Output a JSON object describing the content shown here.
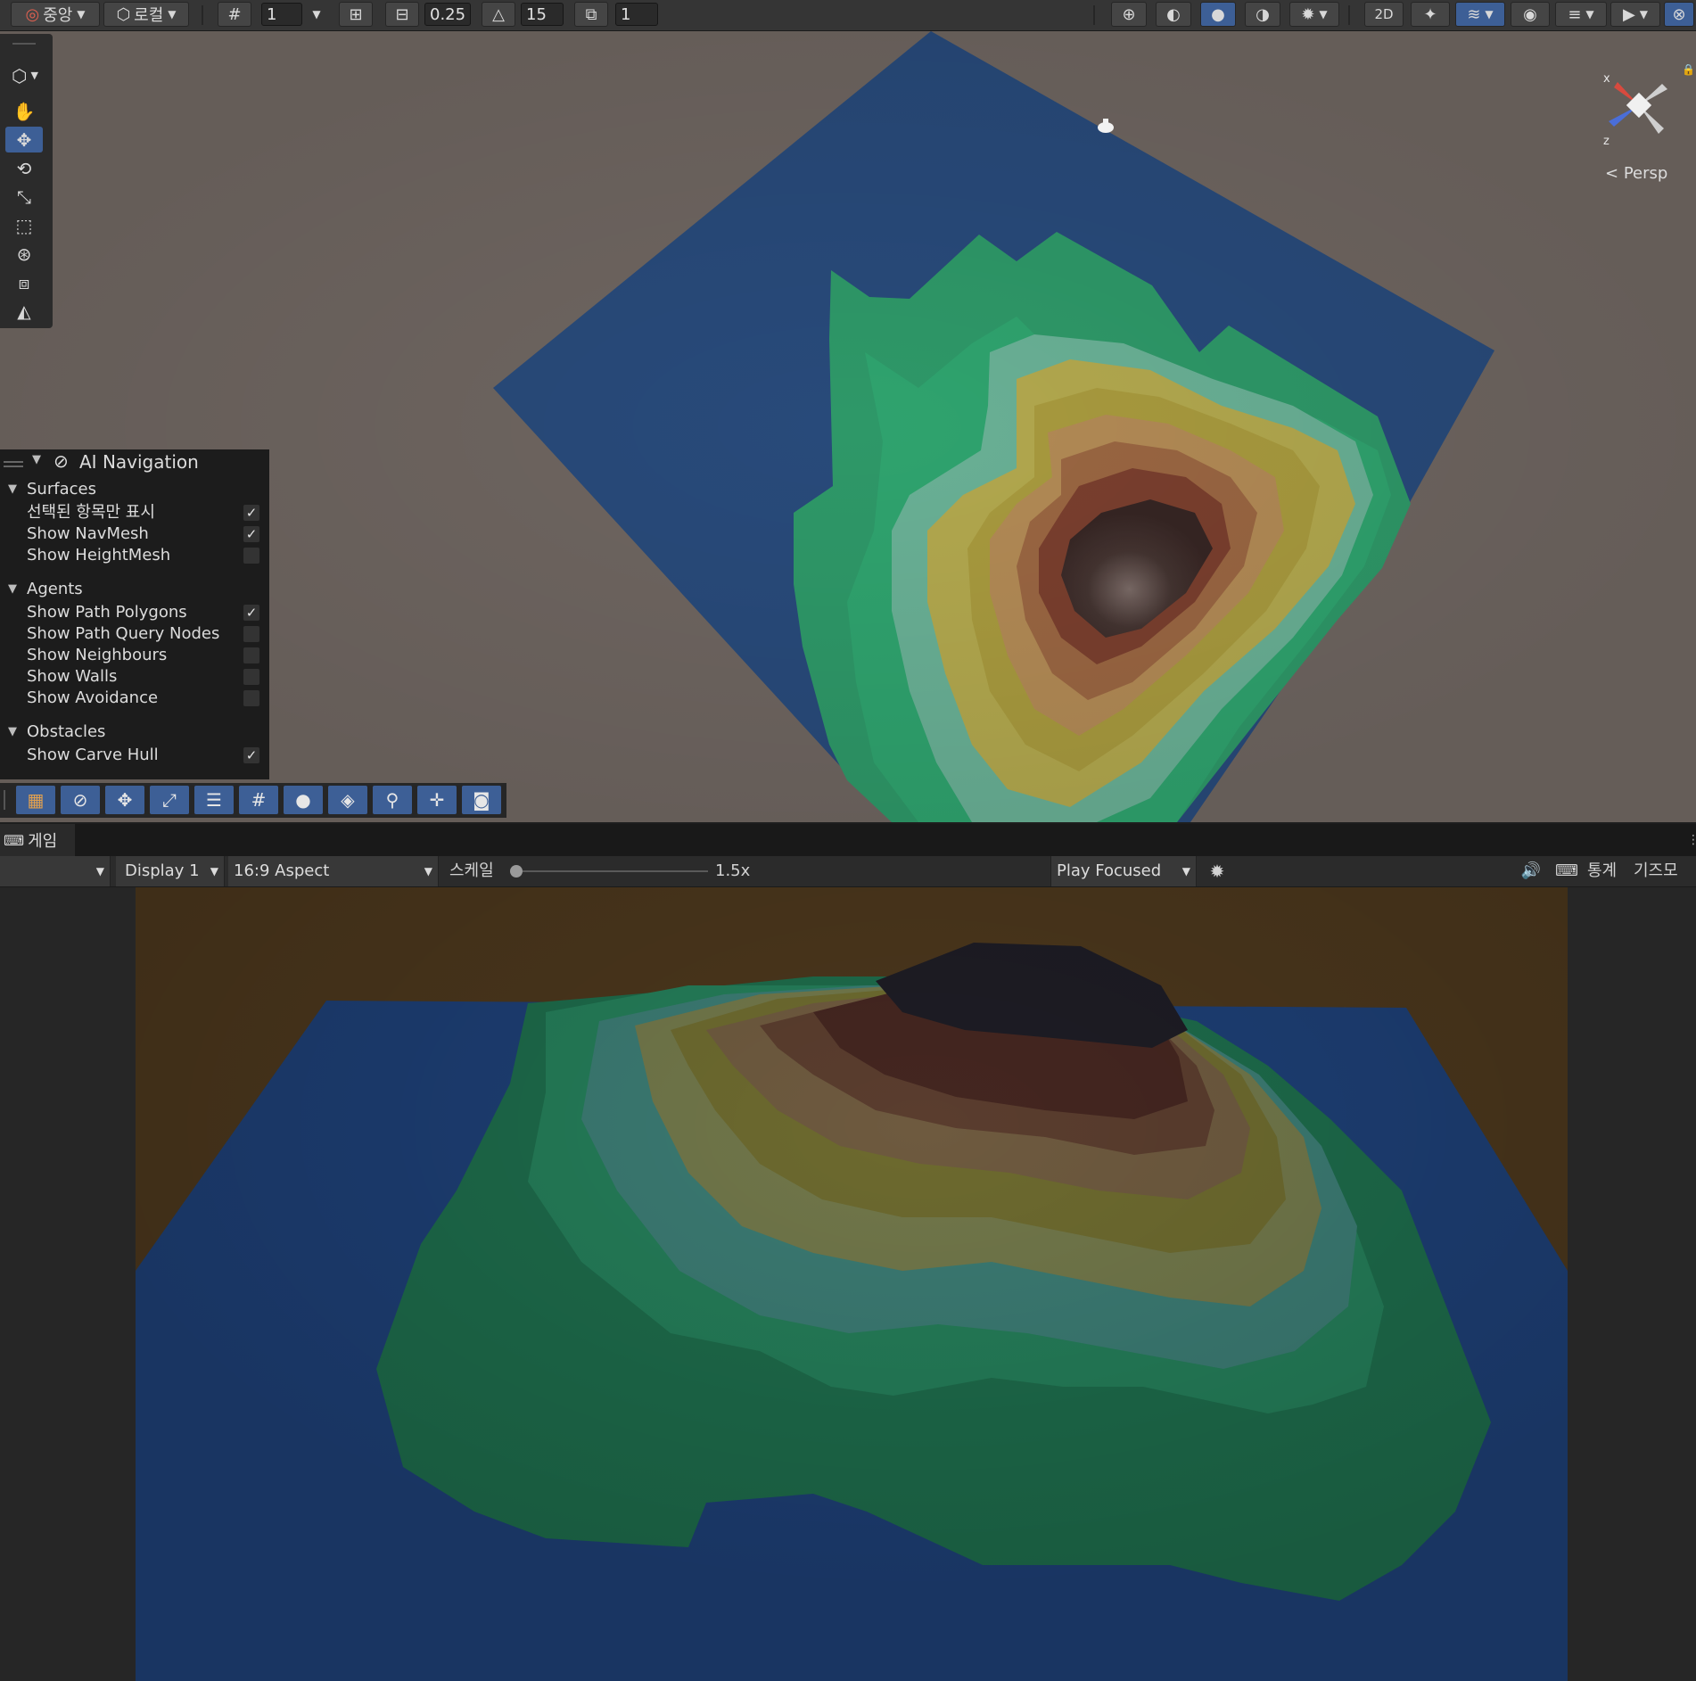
{
  "scene_toolbar": {
    "pivot_label": "중앙",
    "space_label": "로컬",
    "grid_value": "1",
    "snap_increment": "0.25",
    "rotate_snap": "15",
    "scale_snap": "1"
  },
  "scene_view": {
    "projection_label": "Persp",
    "gizmo_x": "x",
    "gizmo_z": "z"
  },
  "ai_navigation": {
    "title": "AI Navigation",
    "sections": [
      {
        "label": "Surfaces",
        "items": [
          {
            "label": "선택된 항목만 표시",
            "checked": true
          },
          {
            "label": "Show NavMesh",
            "checked": true
          },
          {
            "label": "Show HeightMesh",
            "checked": false
          }
        ]
      },
      {
        "label": "Agents",
        "items": [
          {
            "label": "Show Path Polygons",
            "checked": true
          },
          {
            "label": "Show Path Query Nodes",
            "checked": false
          },
          {
            "label": "Show Neighbours",
            "checked": false
          },
          {
            "label": "Show Walls",
            "checked": false
          },
          {
            "label": "Show Avoidance",
            "checked": false
          }
        ]
      },
      {
        "label": "Obstacles",
        "items": [
          {
            "label": "Show Carve Hull",
            "checked": true
          }
        ]
      }
    ]
  },
  "game_view": {
    "tab_label": "게임",
    "display": "Display 1",
    "aspect": "16:9 Aspect",
    "scale_label": "스케일",
    "scale_value": "1.5x",
    "scale_fraction": 0.0,
    "play_mode": "Play Focused",
    "stats_label": "통계",
    "gizmos_label": "기즈모"
  },
  "colors": {
    "accent": "#3d5f96",
    "scene_background": "#6e6560",
    "water": "#284a7a",
    "game_sky": "#4a361c"
  }
}
